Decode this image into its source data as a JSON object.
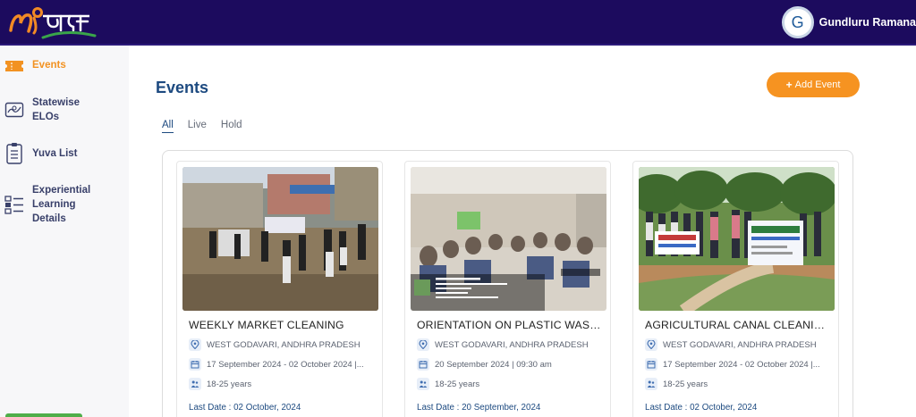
{
  "brand": {
    "logo_text": "मेरा भारत"
  },
  "user": {
    "initial": "G",
    "name": "Gundluru Ramana"
  },
  "sidebar": {
    "items": [
      {
        "label": "Events",
        "icon": "ticket-icon",
        "active": true
      },
      {
        "label": "Statewise ELOs",
        "icon": "map-icon",
        "active": false
      },
      {
        "label": "Yuva List",
        "icon": "clipboard-list-icon",
        "active": false
      },
      {
        "label": "Experiential Learning Details",
        "icon": "grid-list-icon",
        "active": false
      }
    ]
  },
  "main": {
    "title": "Events",
    "add_button": "Add Event",
    "tabs": [
      {
        "label": "All",
        "active": true
      },
      {
        "label": "Live",
        "active": false
      },
      {
        "label": "Hold",
        "active": false
      }
    ]
  },
  "events": [
    {
      "title": "WEEKLY MARKET CLEANING",
      "location": "WEST GODAVARI, ANDHRA PRADESH",
      "date": "17 September 2024 - 02 October 2024 |...",
      "age": "18-25 years",
      "last_date": "Last Date : 02 October, 2024"
    },
    {
      "title": "ORIENTATION ON PLASTIC WASTE...",
      "location": "WEST GODAVARI, ANDHRA PRADESH",
      "date": "20 September 2024 | 09:30 am",
      "age": "18-25 years",
      "last_date": "Last Date : 20 September, 2024"
    },
    {
      "title": "AGRICULTURAL CANAL CLEANING...",
      "location": "WEST GODAVARI, ANDHRA PRADESH",
      "date": "17 September 2024 - 02 October 2024 |...",
      "age": "18-25 years",
      "last_date": "Last Date : 02 October, 2024"
    }
  ],
  "colors": {
    "header_bg": "#1c0b5e",
    "accent_orange": "#f69321",
    "title_blue": "#1d4a80",
    "sidebar_bg": "#f7f7f9"
  }
}
